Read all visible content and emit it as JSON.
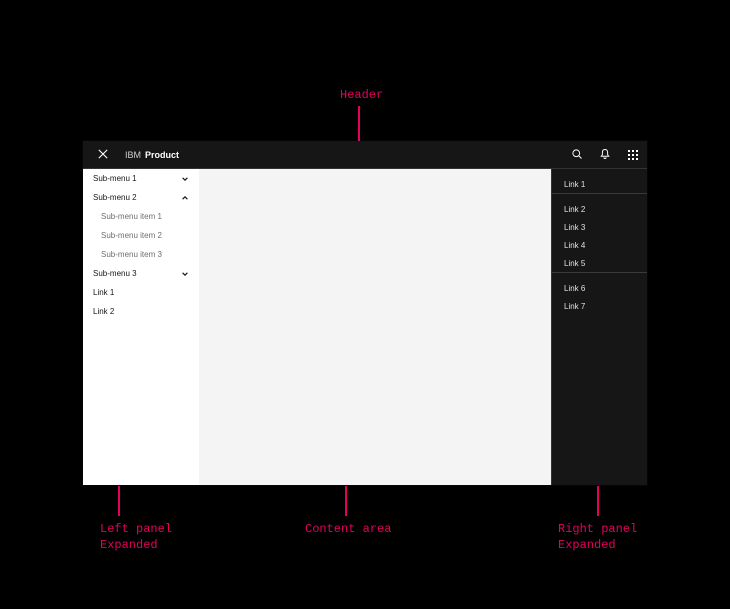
{
  "header": {
    "brand_prefix": "IBM",
    "brand_name": "Product"
  },
  "left_panel": {
    "items": [
      {
        "type": "submenu",
        "label": "Sub-menu 1",
        "expanded": false
      },
      {
        "type": "submenu",
        "label": "Sub-menu 2",
        "expanded": true,
        "children": [
          {
            "label": "Sub-menu item 1"
          },
          {
            "label": "Sub-menu item 2"
          },
          {
            "label": "Sub-menu item 3"
          }
        ]
      },
      {
        "type": "submenu",
        "label": "Sub-menu 3",
        "expanded": false
      },
      {
        "type": "link",
        "label": "Link 1"
      },
      {
        "type": "link",
        "label": "Link 2"
      }
    ]
  },
  "right_panel": {
    "groups": [
      {
        "links": [
          "Link 1"
        ]
      },
      {
        "links": [
          "Link 2",
          "Link 3",
          "Link 4",
          "Link 5"
        ]
      },
      {
        "links": [
          "Link 6",
          "Link 7"
        ]
      }
    ]
  },
  "annotations": {
    "header": "Header",
    "left_panel": "Left panel\nExpanded",
    "content": "Content area",
    "right_panel": "Right panel\nExpanded"
  },
  "colors": {
    "accent": "#e6005c"
  }
}
